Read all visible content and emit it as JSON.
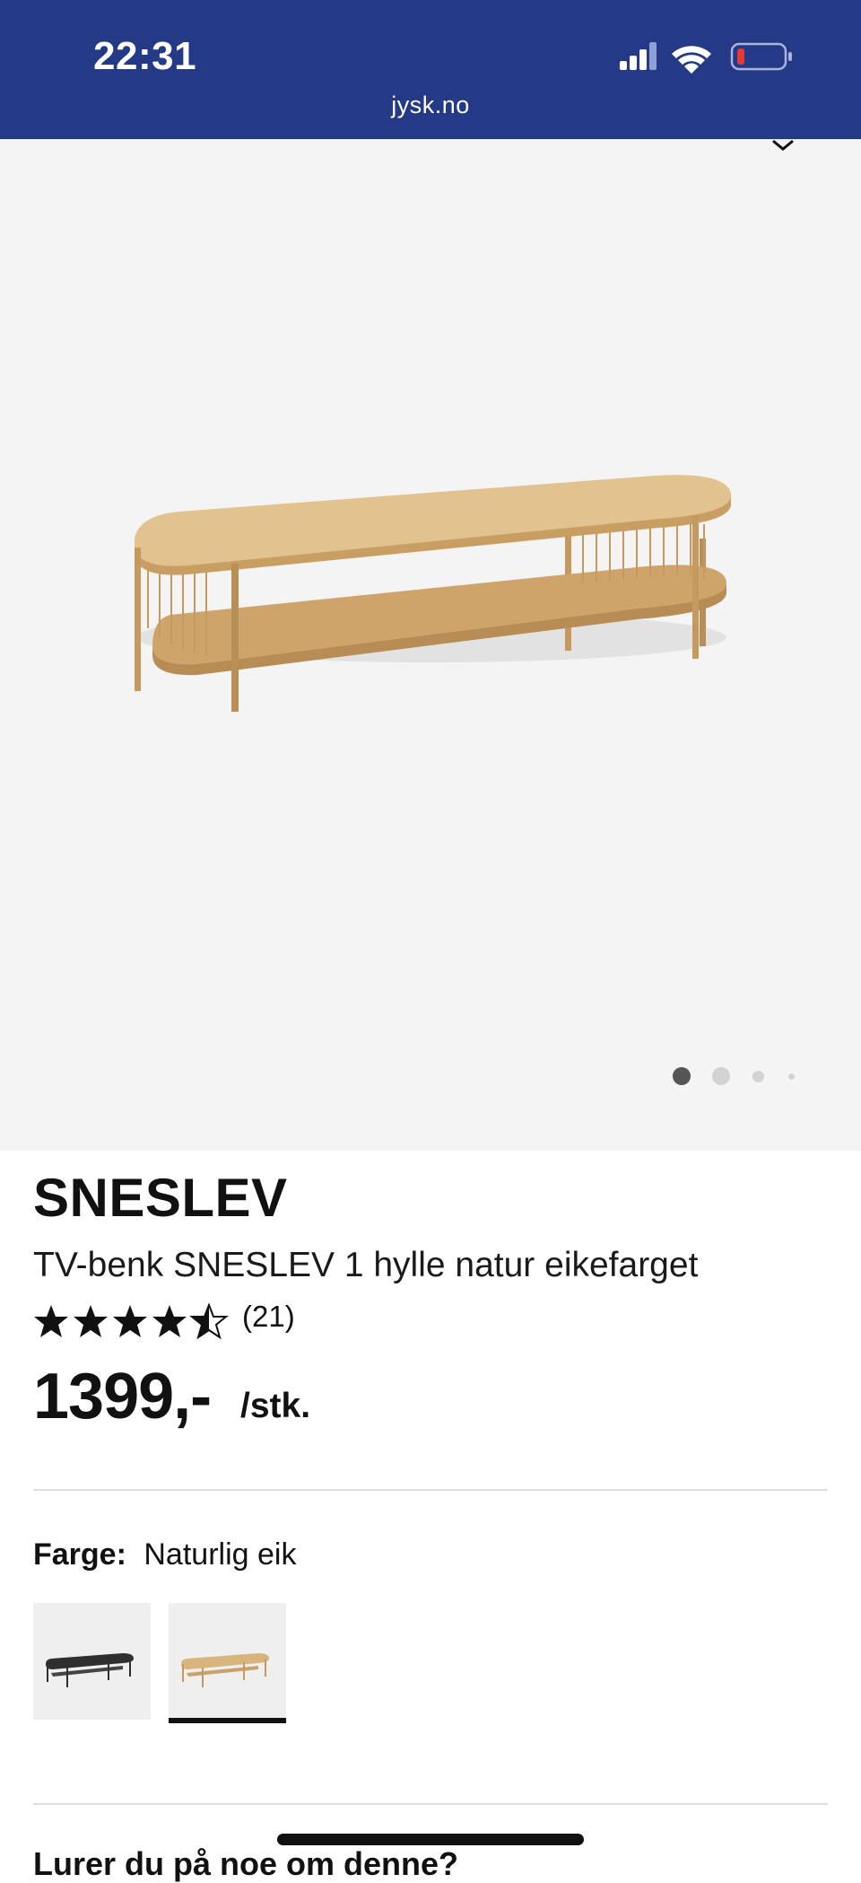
{
  "status_bar": {
    "time": "22:31",
    "url": "jysk.no",
    "icons": [
      "signal-icon",
      "wifi-icon",
      "battery-low-icon"
    ],
    "battery_color": "#e53935"
  },
  "gallery": {
    "image_count": 4,
    "active_index": 0,
    "icon": "chevron-down-icon"
  },
  "product": {
    "brand": "SNESLEV",
    "name": "TV-benk SNESLEV 1 hylle natur eikefarget",
    "rating": 4.5,
    "review_count": "(21)",
    "price": "1399,-",
    "unit": "/stk."
  },
  "variant": {
    "label": "Farge:",
    "value": "Naturlig eik",
    "options": [
      {
        "name": "black-variant",
        "color": "#2f2f2f",
        "selected": false
      },
      {
        "name": "natural-oak-variant",
        "color": "#d7b480",
        "selected": true
      }
    ]
  },
  "next_section": {
    "heading": "Lurer du på noe om denne?"
  },
  "colors": {
    "header_bg": "#243a86",
    "hero_bg": "#f4f4f4",
    "accent": "#111111"
  }
}
